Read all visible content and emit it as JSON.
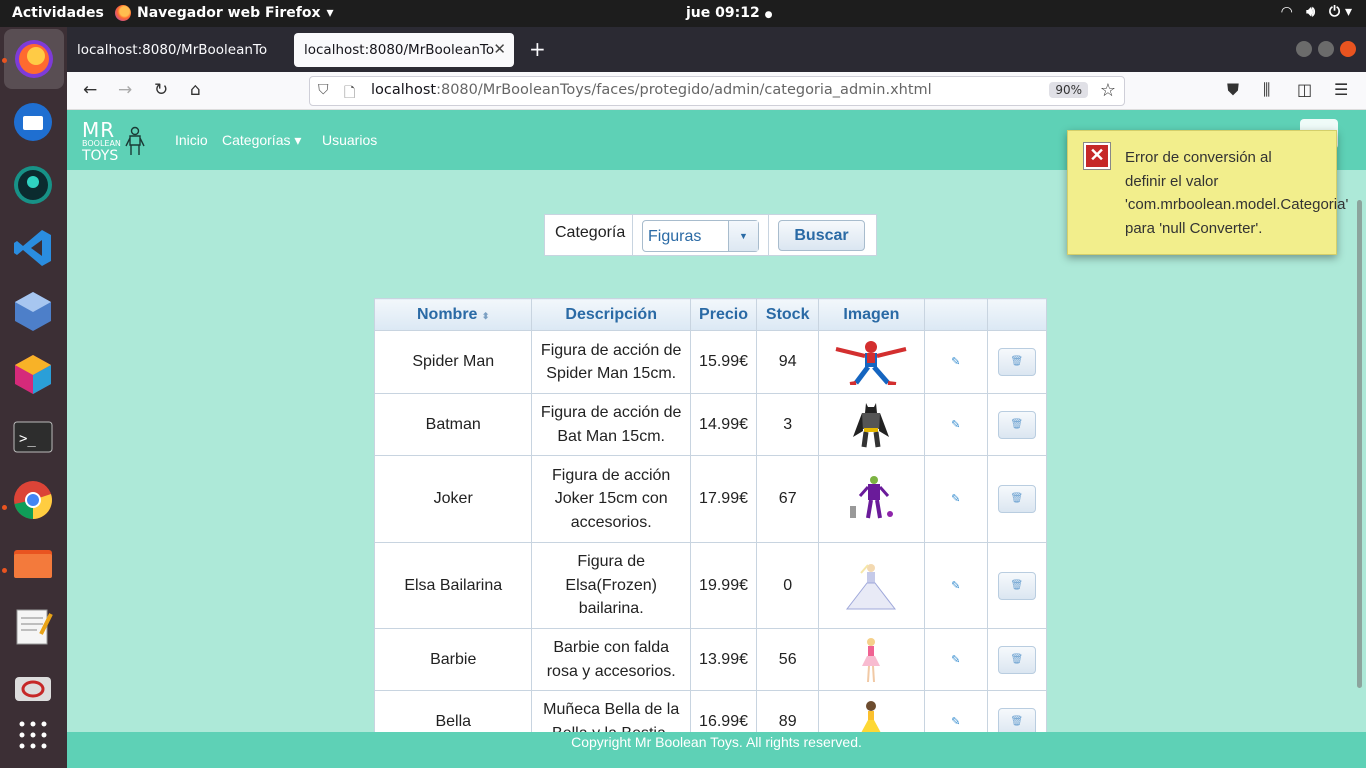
{
  "system": {
    "activities": "Actividades",
    "app_name": "Navegador web Firefox",
    "clock": "jue 09:12"
  },
  "browser": {
    "tabs": [
      {
        "title": "localhost:8080/MrBooleanTo"
      },
      {
        "title": "localhost:8080/MrBooleanTo"
      }
    ],
    "url_host": "localhost",
    "url_rest": ":8080/MrBooleanToys/faces/protegido/admin/categoria_admin.xhtml",
    "zoom": "90%"
  },
  "site": {
    "logo_mr": "MR",
    "logo_boolean": "BOOLEAN",
    "logo_toys": "TOYS",
    "nav": {
      "inicio": "Inicio",
      "categorias": "Categorías ▾",
      "usuarios": "Usuarios"
    }
  },
  "filter": {
    "label": "Categoría",
    "selected": "Figuras",
    "button": "Buscar"
  },
  "table": {
    "headers": [
      "Nombre",
      "Descripción",
      "Precio",
      "Stock",
      "Imagen"
    ],
    "rows": [
      {
        "nombre": "Spider Man",
        "descripcion": "Figura de acción de Spider Man 15cm.",
        "precio": "15.99€",
        "stock": "94",
        "image": "spiderman-figure"
      },
      {
        "nombre": "Batman",
        "descripcion": "Figura de acción de Bat Man 15cm.",
        "precio": "14.99€",
        "stock": "3",
        "image": "batman-figure"
      },
      {
        "nombre": "Joker",
        "descripcion": "Figura de acción Joker 15cm con accesorios.",
        "precio": "17.99€",
        "stock": "67",
        "image": "joker-figure"
      },
      {
        "nombre": "Elsa Bailarina",
        "descripcion": "Figura de Elsa(Frozen) bailarina.",
        "precio": "19.99€",
        "stock": "0",
        "image": "elsa-figure"
      },
      {
        "nombre": "Barbie",
        "descripcion": "Barbie con falda rosa y accesorios.",
        "precio": "13.99€",
        "stock": "56",
        "image": "barbie-figure"
      },
      {
        "nombre": "Bella",
        "descripcion": "Muñeca Bella de la Bella y la Bestia.",
        "precio": "16.99€",
        "stock": "89",
        "image": "bella-figure"
      }
    ]
  },
  "footer": "Copyright Mr Boolean Toys. All rights reserved.",
  "growl": {
    "message": "Error de conversión al\ndefinir el valor\n'com.mrboolean.model.Categoria'\npara 'null Converter'."
  }
}
